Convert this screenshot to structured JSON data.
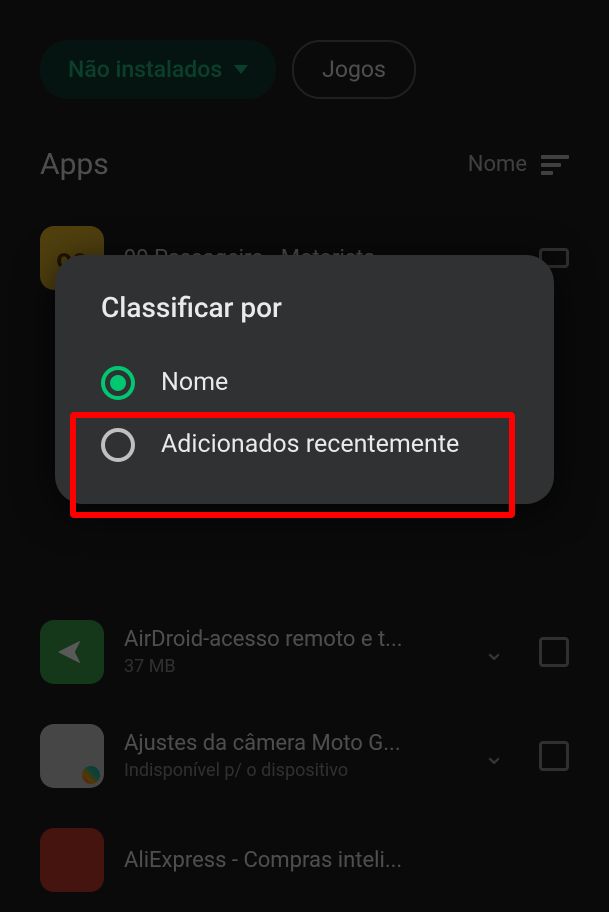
{
  "filters": {
    "installed_label": "Não instalados",
    "games_label": "Jogos"
  },
  "section": {
    "title": "Apps",
    "sort_label": "Nome"
  },
  "apps": [
    {
      "title": "99 Passageiro - Motorista...",
      "subtitle": ""
    },
    {
      "title": "AirDroid-acesso remoto e t...",
      "subtitle": "37 MB"
    },
    {
      "title": "Ajustes da câmera Moto G...",
      "subtitle": "Indisponível p/ o dispositivo"
    },
    {
      "title": "AliExpress - Compras inteli...",
      "subtitle": ""
    }
  ],
  "dialog": {
    "title": "Classificar por",
    "options": [
      {
        "label": "Nome",
        "selected": true
      },
      {
        "label": "Adicionados recentemente",
        "selected": false
      }
    ]
  }
}
